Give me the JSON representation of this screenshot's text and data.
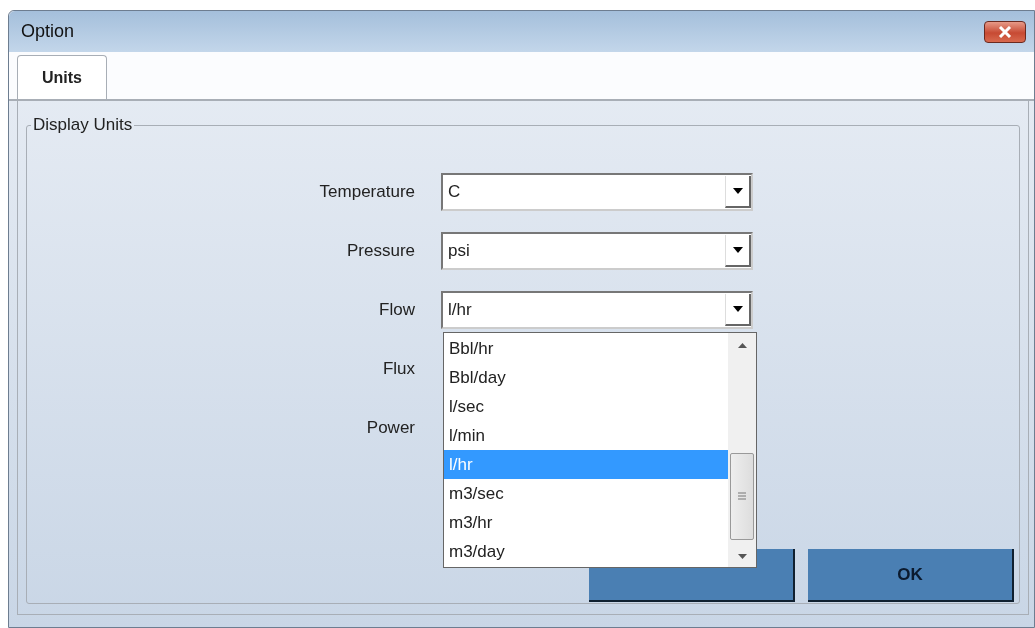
{
  "window": {
    "title": "Option"
  },
  "tabs": [
    {
      "label": "Units",
      "selected": true
    }
  ],
  "group": {
    "title": "Display Units"
  },
  "fields": [
    {
      "label": "Temperature",
      "value": "C"
    },
    {
      "label": "Pressure",
      "value": "psi"
    },
    {
      "label": "Flow",
      "value": "l/hr",
      "dropdown": [
        {
          "label": "Bbl/hr",
          "selected": false
        },
        {
          "label": "Bbl/day",
          "selected": false
        },
        {
          "label": "l/sec",
          "selected": false
        },
        {
          "label": "l/min",
          "selected": false
        },
        {
          "label": "l/hr",
          "selected": true
        },
        {
          "label": "m3/sec",
          "selected": false
        },
        {
          "label": "m3/hr",
          "selected": false
        },
        {
          "label": "m3/day",
          "selected": false
        }
      ]
    },
    {
      "label": "Flux"
    },
    {
      "label": "Power"
    }
  ],
  "buttons": [
    {
      "kind": "covered"
    },
    {
      "kind": "text",
      "label": "OK"
    }
  ]
}
